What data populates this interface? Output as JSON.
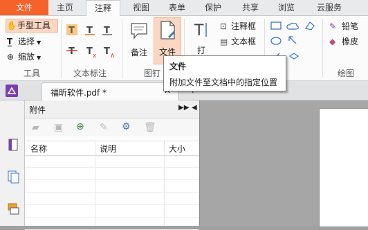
{
  "menu": {
    "tabs": [
      "文件",
      "主页",
      "注释",
      "视图",
      "表单",
      "保护",
      "共享",
      "浏览",
      "云服务"
    ],
    "active_index": 2
  },
  "ribbon": {
    "tools": {
      "hand": "手型工具",
      "select": "选择",
      "zoom": "缩放",
      "group": "工具"
    },
    "text_markup": {
      "group": "文本标注"
    },
    "pin": {
      "note": "备注",
      "file": "文件",
      "group": "图钉"
    },
    "typewriter": {
      "label": "打"
    },
    "comment": {
      "callout": "注释框",
      "textbox": "文本框"
    },
    "drawing": {
      "pencil": "铅笔",
      "eraser": "橡皮",
      "group": "绘图"
    }
  },
  "tooltip": {
    "title": "文件",
    "body": "附加文件至文档中的指定位置"
  },
  "doc_tab": {
    "title": "福昕软件.pdf *"
  },
  "attachments": {
    "title": "附件",
    "columns": [
      "名称",
      "说明",
      "大小"
    ]
  },
  "colors": {
    "accent": "#f5622a",
    "highlight": "#fbd7c2"
  }
}
